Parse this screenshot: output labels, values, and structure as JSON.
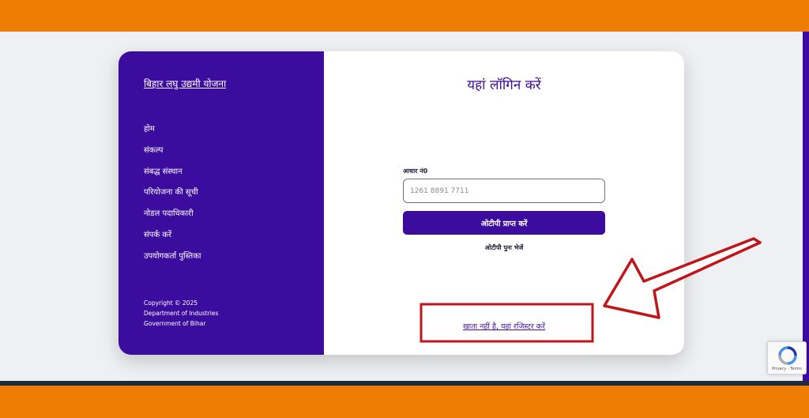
{
  "sidebar": {
    "brand": "बिहार लघु उद्यमी योजना",
    "items": [
      {
        "label": "होम"
      },
      {
        "label": "संकल्प"
      },
      {
        "label": "संबद्ध संस्थान"
      },
      {
        "label": "परियोजना की सूची"
      },
      {
        "label": "नोडल पदाधिकारी"
      },
      {
        "label": "संपर्क करें"
      },
      {
        "label": "उपयोगकर्ता पुस्तिका"
      }
    ],
    "footer": {
      "copyright": "Copyright © 2025",
      "dept": "Department of Industries",
      "govt": "Government of Bihar"
    }
  },
  "login": {
    "title": "यहां लॉगिन करें",
    "aadhaar_label": "आधार नं0",
    "aadhaar_placeholder": "1261 8891 7711",
    "otp_button": "ओटीपी प्राप्त करें",
    "resend_otp": "ओटीपी पुनः भेजें",
    "register_link": "खाता नहीं है, यहां रजिस्टर करें"
  },
  "recaptcha": {
    "terms": "Privacy - Terms"
  },
  "colors": {
    "frame": "#ee7d06",
    "primary": "#3c0c9f",
    "annotation": "#c0161b"
  }
}
